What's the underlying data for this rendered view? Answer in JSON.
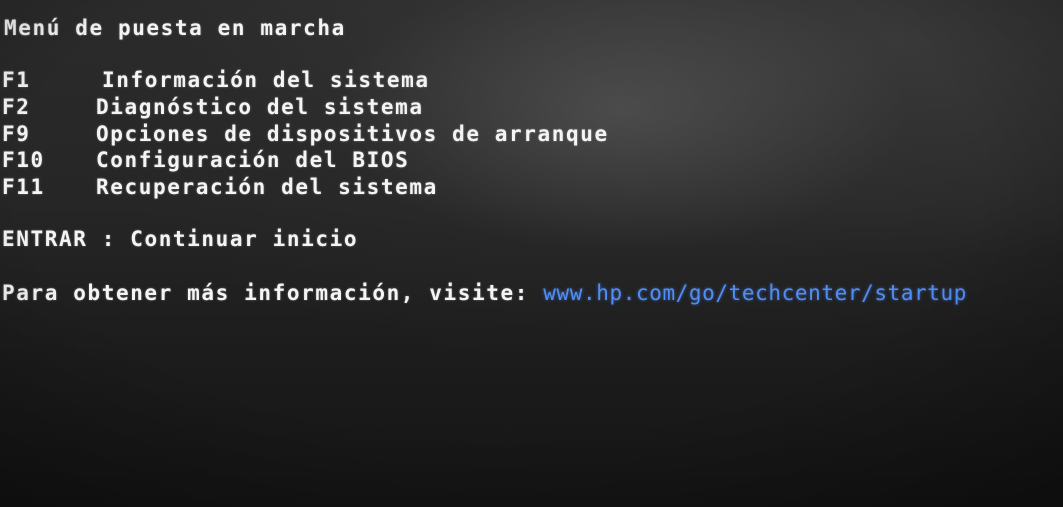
{
  "title": "Menú de puesta en marcha",
  "menu": [
    {
      "key": "F1",
      "label": "Información del sistema"
    },
    {
      "key": "F2",
      "label": "Diagnóstico del sistema"
    },
    {
      "key": "F9",
      "label": "Opciones de dispositivos de arranque"
    },
    {
      "key": "F10",
      "label": "Configuración del BIOS"
    },
    {
      "key": "F11",
      "label": "Recuperación del sistema"
    }
  ],
  "enter": {
    "key": "ENTRAR",
    "separator": " : ",
    "label": "Continuar inicio"
  },
  "info": {
    "text": "Para obtener más información, visite: ",
    "link": "www.hp.com/go/techcenter/startup"
  },
  "colors": {
    "text": "#f4f4f4",
    "link": "#4f8ef7",
    "background": "#262626"
  }
}
